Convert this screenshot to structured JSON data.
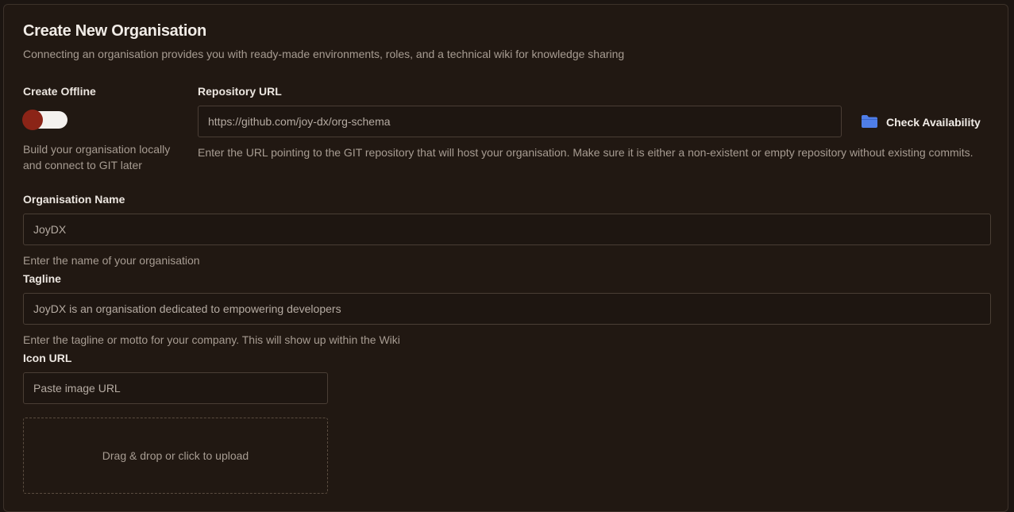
{
  "header": {
    "title": "Create New Organisation",
    "subtitle": "Connecting an organisation provides you with ready-made environments, roles, and a technical wiki for knowledge sharing"
  },
  "offline": {
    "label": "Create Offline",
    "toggle_on": true,
    "help": "Build your organisation locally and connect to GIT later"
  },
  "repository": {
    "label": "Repository URL",
    "value": "https://github.com/joy-dx/org-schema",
    "check_label": "Check Availability",
    "check_icon": "folder-icon",
    "help": "Enter the URL pointing to the GIT repository that will host your organisation. Make sure it is either a non-existent or empty repository without existing commits."
  },
  "org_name": {
    "label": "Organisation Name",
    "value": "JoyDX",
    "help": "Enter the name of your organisation"
  },
  "tagline": {
    "label": "Tagline",
    "value": "JoyDX is an organisation dedicated to empowering developers",
    "help": "Enter the tagline or motto for your company. This will show up within the Wiki"
  },
  "icon": {
    "label": "Icon URL",
    "placeholder": "Paste image URL",
    "dropzone_text": "Drag & drop or click to upload"
  },
  "colors": {
    "accent_folder": "#4f7ee8",
    "toggle_knob": "#8b2417",
    "background": "#211812"
  }
}
